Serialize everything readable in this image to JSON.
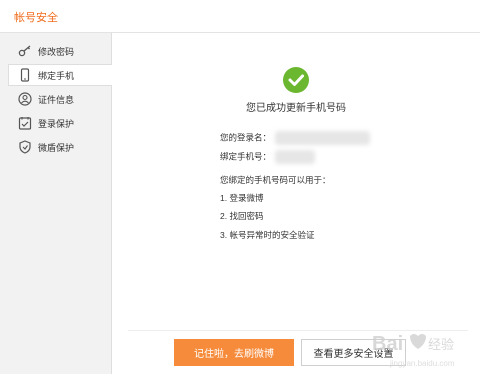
{
  "window": {
    "title": "帐号安全"
  },
  "sidebar": {
    "items": [
      {
        "label": "修改密码"
      },
      {
        "label": "绑定手机"
      },
      {
        "label": "证件信息"
      },
      {
        "label": "登录保护"
      },
      {
        "label": "微盾保护"
      }
    ]
  },
  "main": {
    "success_message": "您已成功更新手机号码",
    "login_name_label": "您的登录名：",
    "phone_label": "绑定手机号：",
    "usage_intro": "您绑定的手机号码可以用于：",
    "usages": [
      "1. 登录微博",
      "2. 找回密码",
      "3. 帐号异常时的安全验证"
    ]
  },
  "footer": {
    "primary_button": "记住啦，去刷微博",
    "secondary_button": "查看更多安全设置"
  },
  "watermark": {
    "text": "Bai 经验",
    "subtext": "jingyan.baidu.com"
  },
  "colors": {
    "accent": "#f06c1c",
    "button": "#f68b3b",
    "success": "#6bb72f"
  }
}
